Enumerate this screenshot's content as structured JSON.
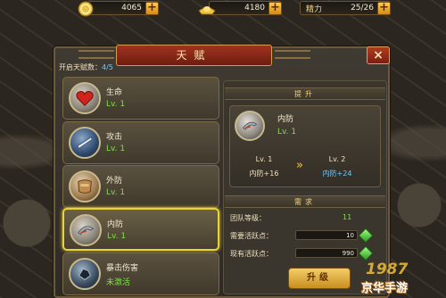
{
  "resources": {
    "coins": "4065",
    "ingots": "4180",
    "stamina_label": "精力",
    "stamina": "25/26"
  },
  "window": {
    "title": "天赋",
    "close": "×"
  },
  "talent_count": {
    "label": "开启天赋数：",
    "value": "4/5"
  },
  "skills": [
    {
      "name": "生命",
      "level": "Lv. 1"
    },
    {
      "name": "攻击",
      "level": "Lv. 1"
    },
    {
      "name": "外防",
      "level": "Lv. 1"
    },
    {
      "name": "内防",
      "level": "Lv. 1"
    },
    {
      "name": "暴击伤害",
      "level": "未激活"
    }
  ],
  "upgrade": {
    "section_title": "提升",
    "name": "内防",
    "level": "Lv. 1",
    "current_level": "Lv. 1",
    "current_stat": "内防+16",
    "next_level": "Lv. 2",
    "next_stat": "内防+24",
    "arrow": "»"
  },
  "requirements": {
    "section_title": "需求",
    "team_level_label": "团队等级：",
    "team_level_value": "11",
    "needed_label": "需要活跃点：",
    "needed_value": "10",
    "owned_label": "现有活跃点：",
    "owned_value": "990"
  },
  "upgrade_button": "升级",
  "watermark": {
    "number": "1987",
    "text": "京华手游"
  },
  "colors": {
    "accent_gold": "#e9d23a",
    "level_green": "#7fe04a",
    "next_stat_blue": "#6ec8ff",
    "title_red": "#a0331f"
  }
}
